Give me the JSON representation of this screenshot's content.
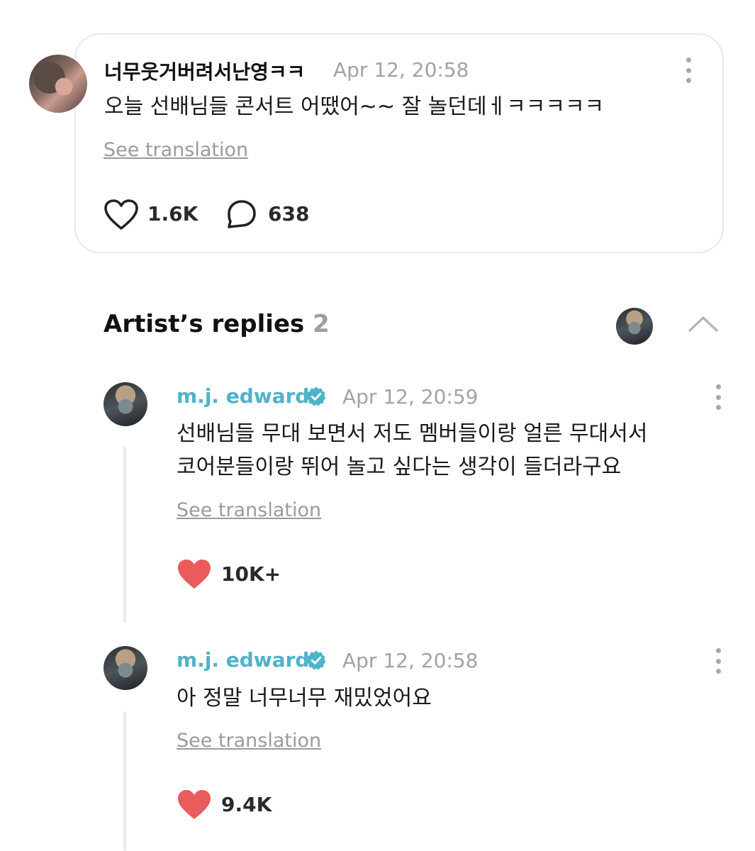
{
  "post": {
    "author": "너무웃거버려서난영ㅋㅋ",
    "time": "Apr 12, 20:58",
    "text": "오늘 선배님들 콘서트 어땠어~~ 잘 놀던데ㅔㅋㅋㅋㅋㅋ",
    "see_translation": "See translation",
    "likes": "1.6K",
    "comments": "638"
  },
  "replies_section": {
    "title": "Artist’s replies",
    "count": "2"
  },
  "replies": [
    {
      "author": "m.j. edwards",
      "time": "Apr 12, 20:59",
      "text_lines": [
        "선배님들 무대 보면서 저도 멤버들이랑 얼른 무대서서",
        "코어분들이랑 뛰어 놀고 싶다는 생각이 들더라구요"
      ],
      "see_translation": "See translation",
      "likes": "10K+"
    },
    {
      "author": "m.j. edwards",
      "time": "Apr 12, 20:58",
      "text_lines": [
        "아 정말 너무너무 재밌었어요"
      ],
      "see_translation": "See translation",
      "likes": "9.4K"
    }
  ],
  "colors": {
    "artist_name": "#4fb3c8",
    "verified_badge": "#4fb3c8",
    "liked_heart": "#ea5b5b",
    "muted_text": "#a2a2a8"
  }
}
